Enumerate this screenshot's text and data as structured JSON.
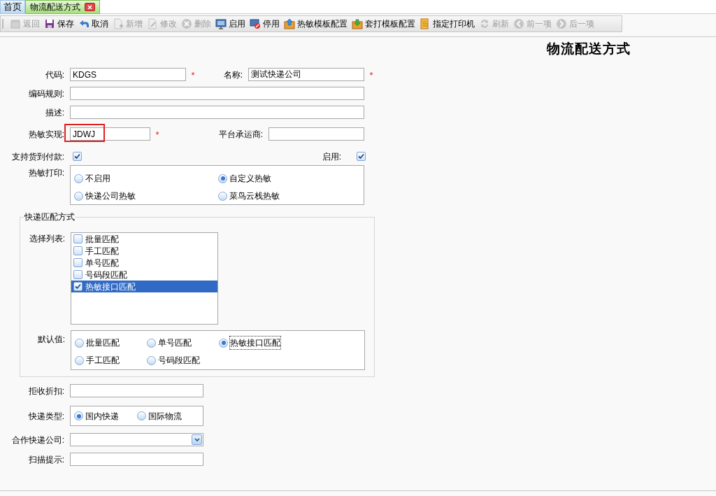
{
  "tabs": [
    {
      "label": "首页",
      "selected": false,
      "closable": false
    },
    {
      "label": "物流配送方式",
      "selected": true,
      "closable": true
    }
  ],
  "toolbar": [
    {
      "kind": "calendar",
      "label": "返回",
      "disabled": true
    },
    {
      "kind": "floppy",
      "label": "保存",
      "disabled": false
    },
    {
      "kind": "undo",
      "label": "取消",
      "disabled": false
    },
    {
      "kind": "doc-plus",
      "label": "新增",
      "disabled": true
    },
    {
      "kind": "doc-edit",
      "label": "修改",
      "disabled": true
    },
    {
      "kind": "x-circle",
      "label": "删除",
      "disabled": true
    },
    {
      "kind": "monitor",
      "label": "启用",
      "disabled": false
    },
    {
      "kind": "monitor-stop",
      "label": "停用",
      "disabled": false
    },
    {
      "kind": "box-up",
      "label": "热敏模板配置",
      "disabled": false
    },
    {
      "kind": "box-down",
      "label": "套打模板配置",
      "disabled": false
    },
    {
      "kind": "printer",
      "label": "指定打印机",
      "disabled": false
    },
    {
      "kind": "refresh",
      "label": "刷新",
      "disabled": true
    },
    {
      "kind": "prev",
      "label": "前一项",
      "disabled": true
    },
    {
      "kind": "next",
      "label": "后一项",
      "disabled": true
    }
  ],
  "page_title": "物流配送方式",
  "form": {
    "code": {
      "label": "代码:",
      "value": "KDGS",
      "required_mark": "*"
    },
    "name": {
      "label": "名称:",
      "value": "测试快递公司",
      "required_mark": "*"
    },
    "coding_rule": {
      "label": "编码规则:"
    },
    "description": {
      "label": "描述:"
    },
    "thermal_impl": {
      "label": "热敏实现:",
      "value": "JDWJ",
      "required_mark": "*",
      "highlighted": true
    },
    "platform_carrier": {
      "label": "平台承运商:"
    },
    "cod": {
      "label": "支持货到付款:",
      "checked": true
    },
    "enabled": {
      "label": "启用:",
      "checked": true
    },
    "thermal_print": {
      "label": "热敏打印:",
      "options": [
        {
          "label": "不启用",
          "selected": false
        },
        {
          "label": "自定义热敏",
          "selected": true
        },
        {
          "label": "快递公司热敏",
          "selected": false
        },
        {
          "label": "菜鸟云栈热敏",
          "selected": false
        }
      ]
    },
    "match_group": {
      "legend": "快递匹配方式",
      "list_label": "选择列表:",
      "list": [
        {
          "label": "批量匹配",
          "checked": false,
          "selected": false
        },
        {
          "label": "手工匹配",
          "checked": false,
          "selected": false
        },
        {
          "label": "单号匹配",
          "checked": false,
          "selected": false
        },
        {
          "label": "号码段匹配",
          "checked": false,
          "selected": false
        },
        {
          "label": "热敏接口匹配",
          "checked": true,
          "selected": true
        }
      ],
      "default_label": "默认值:",
      "default_options": [
        {
          "label": "批量匹配",
          "selected": false
        },
        {
          "label": "单号匹配",
          "selected": false
        },
        {
          "label": "热敏接口匹配",
          "selected": true
        },
        {
          "label": "手工匹配",
          "selected": false
        },
        {
          "label": "号码段匹配",
          "selected": false
        }
      ]
    },
    "reject_discount": {
      "label": "拒收折扣:"
    },
    "express_type": {
      "label": "快递类型:",
      "options": [
        {
          "label": "国内快递",
          "selected": true
        },
        {
          "label": "国际物流",
          "selected": false
        }
      ]
    },
    "partner": {
      "label": "合作快递公司:"
    },
    "scan_hint": {
      "label": "扫描提示:"
    }
  }
}
